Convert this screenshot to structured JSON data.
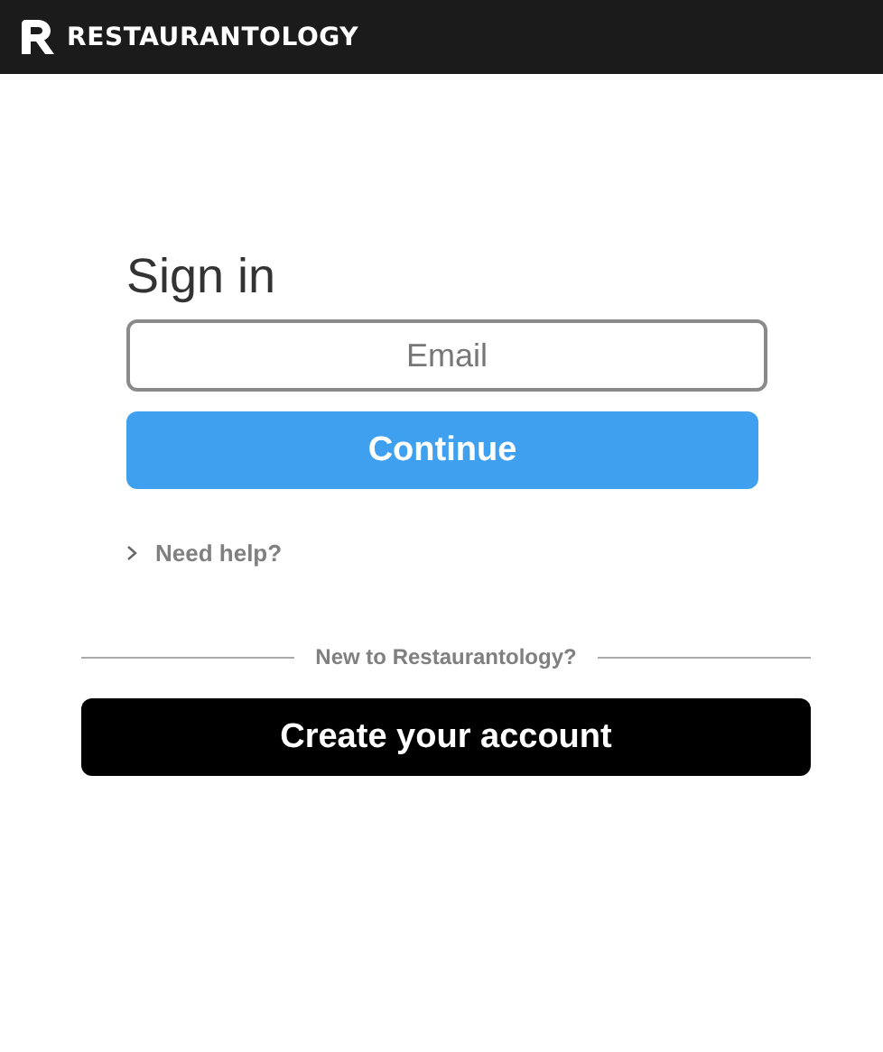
{
  "header": {
    "brand": "RESTAURANTOLOGY"
  },
  "form": {
    "title": "Sign in",
    "email": {
      "placeholder": "Email"
    },
    "submit": "Continue",
    "help": "Need help?"
  },
  "divider": "New to Restaurantology?",
  "create_account": "Create your account"
}
